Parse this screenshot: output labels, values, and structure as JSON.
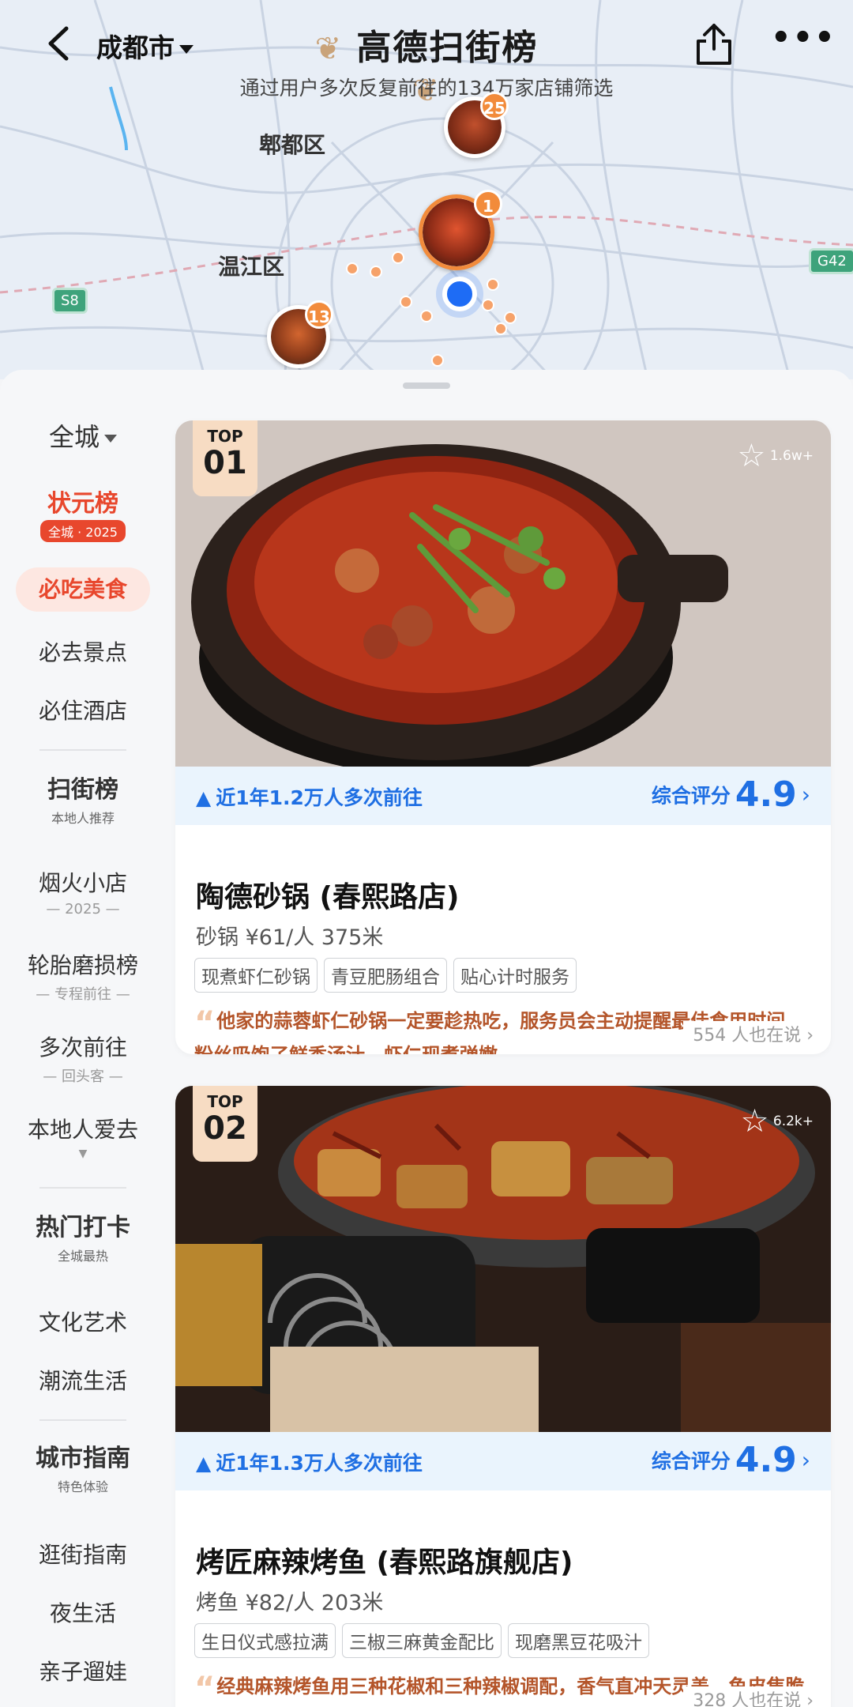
{
  "header": {
    "city": "成都市",
    "brand": "高德扫街榜",
    "subtitle": "通过用户多次反复前往的134万家店铺筛选"
  },
  "map": {
    "districts": [
      "郫都区",
      "温江区"
    ],
    "road_shields": [
      "S8",
      "G42"
    ],
    "pins": [
      "25",
      "1",
      "13"
    ]
  },
  "sidebar": {
    "scope": "全城",
    "sections": [
      {
        "title": "状元榜",
        "badge": "全城 · 2025",
        "items": [
          {
            "label": "必吃美食",
            "active": true
          },
          {
            "label": "必去景点"
          },
          {
            "label": "必住酒店"
          }
        ]
      },
      {
        "title": "扫街榜",
        "badge": "本地人推荐",
        "items": [
          {
            "label": "烟火小店",
            "sub": "— 2025 —"
          },
          {
            "label": "轮胎磨损榜",
            "sub": "— 专程前往 —"
          },
          {
            "label": "多次前往",
            "sub": "— 回头客 —"
          },
          {
            "label": "本地人爱去"
          }
        ]
      },
      {
        "title": "热门打卡",
        "badge": "全城最热",
        "items": [
          {
            "label": "文化艺术"
          },
          {
            "label": "潮流生活"
          }
        ]
      },
      {
        "title": "城市指南",
        "badge": "特色体验",
        "items": [
          {
            "label": "逛街指南"
          },
          {
            "label": "夜生活"
          },
          {
            "label": "亲子遛娃"
          }
        ]
      }
    ]
  },
  "cards": [
    {
      "rank_top": "TOP",
      "rank_num": "01",
      "favorites": "1.6w+",
      "visits": "近1年1.2万人多次前往",
      "score_label": "综合评分",
      "score": "4.9",
      "name": "陶德砂锅 (春熙路店)",
      "meta": "砂锅  ¥61/人  375米",
      "tags": [
        "现煮虾仁砂锅",
        "青豆肥肠组合",
        "贴心计时服务"
      ],
      "quote": "他家的蒜蓉虾仁砂锅一定要趁热吃，服务员会主动提醒最佳食用时间，粉丝吸饱了鲜香汤汁，虾仁现煮弹嫩，...",
      "seeing": "554 人也在说"
    },
    {
      "rank_top": "TOP",
      "rank_num": "02",
      "favorites": "6.2k+",
      "visits": "近1年1.3万人多次前往",
      "score_label": "综合评分",
      "score": "4.9",
      "name": "烤匠麻辣烤鱼 (春熙路旗舰店)",
      "meta": "烤鱼  ¥82/人  203米",
      "tags": [
        "生日仪式感拉满",
        "三椒三麻黄金配比",
        "现磨黑豆花吸汁"
      ],
      "quote": "经典麻辣烤鱼用三种花椒和三种辣椒调配，香气直冲天灵盖，鱼皮焦脆鱼肉嫩滑，越吃越上头，是川味老饕的...",
      "seeing": "328 人也在说"
    }
  ],
  "colors": {
    "accent_blue": "#1f6fe3",
    "accent_red": "#e8472d",
    "pin_orange": "#f28b3b"
  }
}
